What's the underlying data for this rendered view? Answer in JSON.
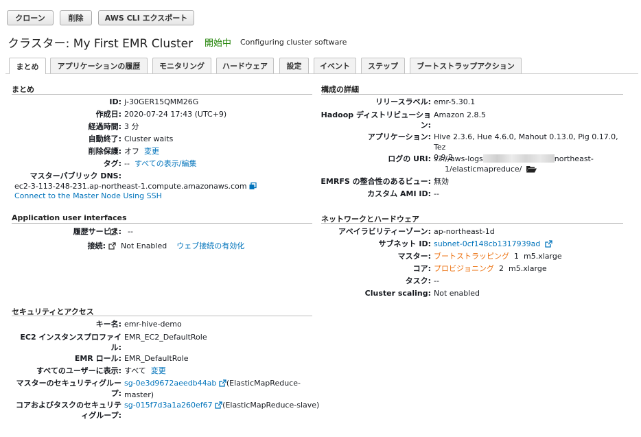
{
  "toolbar": {
    "clone": "クローン",
    "delete": "削除",
    "cli_export": "AWS CLI エクスポート"
  },
  "header": {
    "title": "クラスター: My First EMR Cluster",
    "status": "開始中",
    "status_detail": "Configuring cluster software"
  },
  "tabs": [
    "まとめ",
    "アプリケーションの履歴",
    "モニタリング",
    "ハードウェア",
    "設定",
    "イベント",
    "ステップ",
    "ブートストラップアクション"
  ],
  "summary": {
    "title": "まとめ",
    "id_label": "ID:",
    "id": "j-30GER15QMM26G",
    "created_label": "作成日:",
    "created": "2020-07-24 17:43 (UTC+9)",
    "elapsed_label": "経過時間:",
    "elapsed": "3 分",
    "autoterm_label": "自動終了:",
    "autoterm": "Cluster waits",
    "protect_label": "削除保護:",
    "protect": "オフ",
    "protect_link": "変更",
    "tags_label": "タグ:",
    "tags": "--",
    "tags_link": "すべての表示/編集",
    "dns_label": "マスターパブリック DNS:",
    "dns": "ec2-3-113-248-231.ap-northeast-1.compute.amazonaws.com",
    "ssh_link": "Connect to the Master Node Using SSH"
  },
  "app_ui": {
    "title": "Application user interfaces",
    "history_label": "履歴サービス:",
    "history": "--",
    "conn_label": "接続:",
    "conn": "Not Enabled",
    "conn_link": "ウェブ接続の有効化"
  },
  "security": {
    "title": "セキュリティとアクセス",
    "key_label": "キー名:",
    "key": "emr-hive-demo",
    "profile_label_1": "EC2 インスタンスプロファイ",
    "profile_label_2": "ル:",
    "profile": "EMR_EC2_DefaultRole",
    "role_label": "EMR ロール:",
    "role": "EMR_DefaultRole",
    "visible_label": "すべてのユーザーに表示:",
    "visible": "すべて",
    "visible_link": "変更",
    "master_sg_label_1": "マスターのセキュリティグルー",
    "master_sg_label_2": "プ:",
    "master_sg": "sg-0e3d9672aeedb44ab",
    "master_sg_name_1": "(ElasticMapReduce-",
    "master_sg_name_2": "master)",
    "core_sg_label_1": "コアおよびタスクのセキュリテ",
    "core_sg_label_2": "ィグループ:",
    "core_sg": "sg-015f7d3a1a260ef67",
    "core_sg_name": "(ElasticMapReduce-slave)"
  },
  "config": {
    "title": "構成の詳細",
    "release_label": "リリースラベル:",
    "release": "emr-5.30.1",
    "hadoop_label_1": "Hadoop ディストリビューショ",
    "hadoop_label_2": "ン:",
    "hadoop": "Amazon 2.8.5",
    "apps_label": "アプリケーション:",
    "apps_1": "Hive 2.3.6, Hue 4.6.0, Mahout 0.13.0, Pig 0.17.0, Tez",
    "apps_2": "0.9.2",
    "log_label": "ログの URI:",
    "log_1a": "s3://aws-logs",
    "log_1b": "northeast-",
    "log_2": "1/elasticmapreduce/",
    "emrfs_label": "EMRFS の整合性のあるビュー:",
    "emrfs": "無効",
    "ami_label": "カスタム AMI ID:",
    "ami": "--"
  },
  "network": {
    "title": "ネットワークとハードウェア",
    "az_label": "アベイラビリティーゾーン:",
    "az": "ap-northeast-1d",
    "subnet_label": "サブネット ID:",
    "subnet": "subnet-0cf148cb1317939ad",
    "master_label": "マスター:",
    "master_status": "ブートストラッピング",
    "master_count": "1",
    "master_type": "m5.xlarge",
    "core_label": "コア:",
    "core_status": "プロビジョニング",
    "core_count": "2",
    "core_type": "m5.xlarge",
    "task_label": "タスク:",
    "task": "--",
    "scaling_label": "Cluster scaling:",
    "scaling": "Not enabled"
  }
}
